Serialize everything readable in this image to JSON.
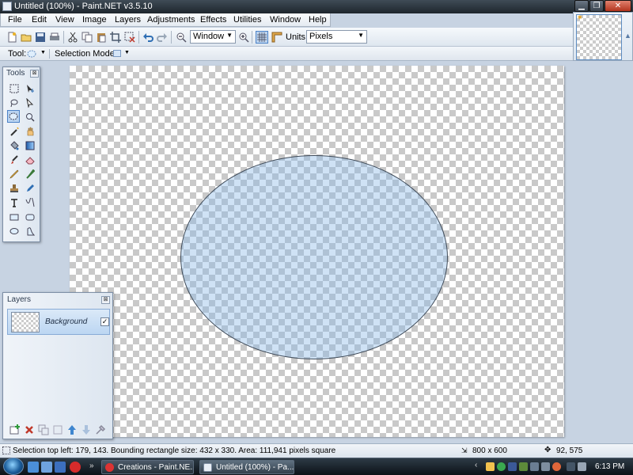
{
  "window": {
    "title": "Untitled (100%) - Paint.NET v3.5.10",
    "minimize_glyph": "▁",
    "maximize_glyph": "❐",
    "close_glyph": "✕"
  },
  "menu": {
    "items": [
      "File",
      "Edit",
      "View",
      "Image",
      "Layers",
      "Adjustments",
      "Effects",
      "Utilities",
      "Window",
      "Help"
    ]
  },
  "toolbar": {
    "zoom_value": "Window",
    "units_label": "Units:",
    "units_value": "Pixels",
    "tool_label": "Tool:",
    "selection_mode_label": "Selection Mode:"
  },
  "tools_panel": {
    "title": "Tools",
    "close_glyph": "⊠"
  },
  "layers_panel": {
    "title": "Layers",
    "close_glyph": "⊠",
    "layers": [
      {
        "name": "Background",
        "visible_glyph": "✓"
      }
    ]
  },
  "status": {
    "selection_info": "Selection top left: 179, 143. Bounding rectangle size: 432 x 330. Area: 111,941 pixels square",
    "image_size": "800 x 600",
    "cursor_position": "92, 575"
  },
  "taskbar": {
    "tasks": [
      "Creations - Paint.NE...",
      "Untitled (100%) - Pa..."
    ],
    "chevron": "»",
    "clock": "6:13 PM"
  },
  "colors": {
    "selection_fill": "#8cb9e8",
    "titlebar": "#2b353f",
    "workspace": "#c7d3e2",
    "accent": "#4c82c7"
  }
}
